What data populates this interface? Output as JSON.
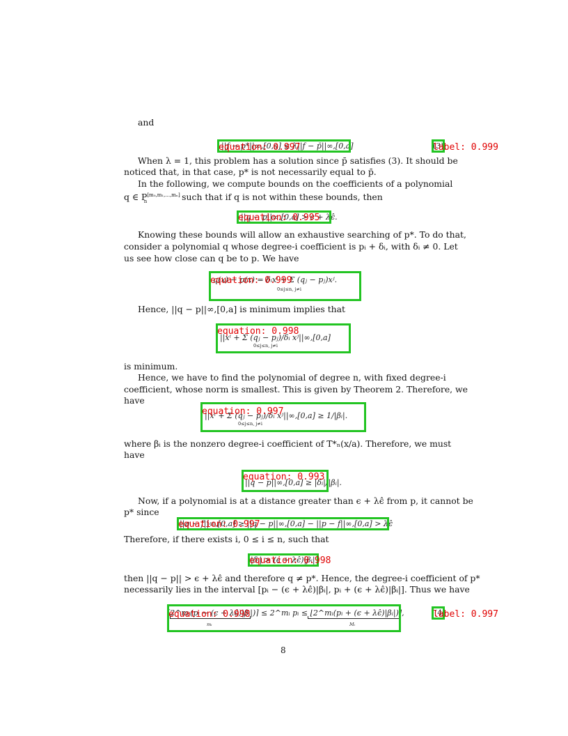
{
  "paragraphs": {
    "and": "and",
    "p1_l1": "When λ = 1, this problem has a solution since p̄ satisfies (3). It should be",
    "p1_l2": "noticed that, in that case, p* is not necessarily equal to p̄.",
    "p2_l1": "In the following, we compute bounds on the coefficients of a polynomial",
    "p2_l2a": "q ∈ P",
    "p2_l2sup": "[m₀,m₁,...,mₙ]",
    "p2_l2sub": "n",
    "p2_l2b": "such that if q is not within these bounds, then",
    "p3_l1": "Knowing these bounds will allow an exhaustive searching of p*. To do that,",
    "p3_l2": "consider a polynomial q whose degree-i coefficient is pᵢ + δᵢ, with δᵢ ≠ 0. Let",
    "p3_l3": "us see how close can q be to p. We have",
    "p4_l1": "Hence, ||q − p||∞,[0,a] is minimum implies that",
    "p5_l1": "is minimum.",
    "p6_l1": "Hence, we have to find the polynomial of degree n, with fixed degree-i",
    "p6_l2": "coefficient, whose norm is smallest. This is given by Theorem 2. Therefore, we",
    "p6_l3": "have",
    "p7_l1": "where βᵢ is the nonzero degree-i coefficient of T*ₙ(x/a). Therefore, we must",
    "p7_l2": "have",
    "p8_l1": "Now, if a polynomial is at a distance greater than ϵ + λϵ̂ from p, it cannot be",
    "p8_l2": "p* since",
    "p9_l1": "Therefore, if there exists i, 0 ≤ i ≤ n, such that",
    "p10_l1": "then ||q − p|| > ϵ + λϵ̂ and therefore q ≠ p*. Hence, the degree-i coefficient of p*",
    "p10_l2": "necessarily lies in the interval [pᵢ − (ϵ + λϵ̂)|βᵢ|, pᵢ + (ϵ + λϵ̂)|βᵢ|]. Thus we have",
    "page_number": "8"
  },
  "equations": {
    "eq1": "||f − p*||∞,[0,a] ≤ λ||f − p̄||∞,[0,a]",
    "eq1_number": "(3)",
    "eq2": "||q − p||∞,[0,a] > ϵ + λϵ̂.",
    "eq3": "q(x) − p(x) = δᵢxⁱ + Σ (qⱼ − pⱼ)xʲ.",
    "eq3_sub": "0≤j≤n, j≠i",
    "eq4": "||xⁱ + Σ (qⱼ − pⱼ)/δᵢ xʲ||∞,[0,a]",
    "eq4_sub": "0≤j≤n, j≠i",
    "eq5": "||xⁱ + Σ (qⱼ − pⱼ)/δᵢ xʲ||∞,[0,a] ≥ 1/|βᵢ|.",
    "eq5_sub": "0≤j≤n, j≠i",
    "eq6": "||q − p||∞,[0,a] ≥ |δᵢ|/|βᵢ|.",
    "eq7": "||q − f||∞,[0,a] ≥ ||q − p||∞,[0,a] − ||p − f||∞,[0,a] > λϵ̂",
    "eq8": "|δᵢ| > (ϵ + λϵ̂)|βᵢ|",
    "eq9": "⌈2^mᵢ(pᵢ − (ϵ + λϵ̂)|βᵢ|)⌉ ≤ 2^mᵢ pᵢ ≤ ⌊2^mᵢ(pᵢ + (ϵ + λϵ̂)|βᵢ|)⌋,",
    "eq9_under_left": "mᵢ",
    "eq9_under_right": "Mᵢ",
    "eq9_number": "(4)"
  },
  "detections": [
    {
      "label": "equation: 0.997"
    },
    {
      "label": "label: 0.999"
    },
    {
      "label": "equation: 0.995"
    },
    {
      "label": "equation: 0.999"
    },
    {
      "label": "equation: 0.998"
    },
    {
      "label": "equation: 0.997"
    },
    {
      "label": "equation: 0.993"
    },
    {
      "label": "equation: 0.997"
    },
    {
      "label": "equation: 0.998"
    },
    {
      "label": "equation: 0.998"
    },
    {
      "label": "label: 0.997"
    }
  ],
  "colors": {
    "box": "#22c422",
    "tag": "#e00000"
  }
}
